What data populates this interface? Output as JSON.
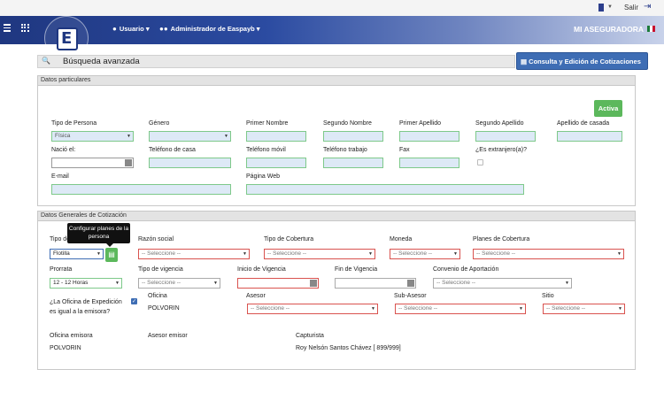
{
  "topbar": {
    "salir_label": "Salir"
  },
  "navbar": {
    "usuario_label": "Usuario",
    "admin_label": "Administrador de Easpayb",
    "brand": "MI ASEGURADORA"
  },
  "search": {
    "title": "Búsqueda avanzada",
    "consulta_button": "Consulta y Edición de Cotizaciones"
  },
  "datos_particulares": {
    "header": "Datos particulares",
    "activa_label": "Activa",
    "labels": {
      "tipo_persona": "Tipo de Persona",
      "genero": "Género",
      "primer_nombre": "Primer Nombre",
      "segundo_nombre": "Segundo Nombre",
      "primer_apellido": "Primer Apellido",
      "segundo_apellido": "Segundo Apellido",
      "apellido_casada": "Apellido de casada",
      "nacio": "Nació el:",
      "tel_casa": "Teléfono de casa",
      "tel_movil": "Teléfono móvil",
      "tel_trabajo": "Teléfono trabajo",
      "fax": "Fax",
      "extranjero": "¿Es extranjero(a)?",
      "email": "E-mail",
      "pagina_web": "Página Web"
    },
    "tipo_persona_value": "Física"
  },
  "datos_generales": {
    "header": "Datos Generales de Cotización",
    "tooltip": "Configurar planes de la persona",
    "labels": {
      "tipo": "Tipo de",
      "razon_social": "Razón social",
      "tipo_cobertura": "Tipo de Cobertura",
      "moneda": "Moneda",
      "planes_cobertura": "Planes de Cobertura",
      "prorrata": "Prorrata",
      "tipo_vigencia": "Tipo de vigencia",
      "inicio_vigencia": "Inicio de Vigencia",
      "fin_vigencia": "Fin de Vigencia",
      "convenio": "Convenio de Aportación",
      "oficina_q": "¿La Oficina de Expedición es igual a la emisora?",
      "oficina": "Oficina",
      "asesor": "Asesor",
      "sub_asesor": "Sub-Asesor",
      "sitio": "Sitio",
      "oficina_emisora": "Oficina emisora",
      "asesor_emisor": "Asesor emisor",
      "capturista": "Capturista"
    },
    "values": {
      "tipo": "Flotilla",
      "seleccione_short": "-- Seleccione --",
      "seleccione_long": "-- Seleccione --",
      "prorrata": "12 - 12 Horas",
      "oficina": "POLVORIN",
      "oficina_emisora": "POLVORIN",
      "capturista": "Roy Nelsón Santos Chávez [ 899/999]"
    }
  }
}
